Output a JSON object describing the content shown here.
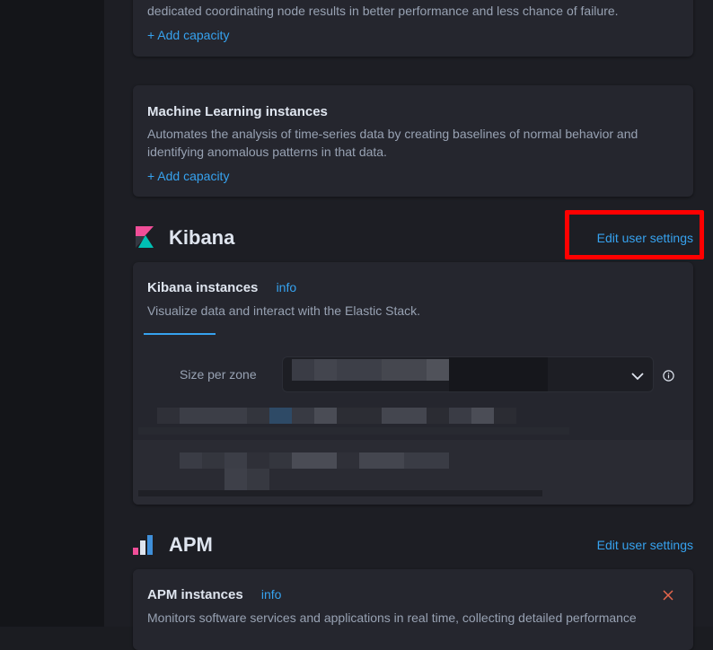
{
  "coordinating": {
    "desc_tail": "dedicated coordinating node results in better performance and less chance of failure.",
    "add_capacity": "+ Add capacity"
  },
  "ml": {
    "title": "Machine Learning instances",
    "desc": "Automates the analysis of time-series data by creating baselines of normal behavior and identifying anomalous patterns in that data.",
    "add_capacity": "+ Add capacity"
  },
  "kibana": {
    "section_title": "Kibana",
    "edit_settings": "Edit user settings",
    "card_title": "Kibana instances",
    "info": "info",
    "desc": "Visualize data and interact with the Elastic Stack.",
    "size_label": "Size per zone"
  },
  "apm": {
    "section_title": "APM",
    "edit_settings": "Edit user settings",
    "card_title": "APM instances",
    "info": "info",
    "desc": "Monitors software services and applications in real time, collecting detailed performance"
  },
  "colors": {
    "accent": "#36a2ef",
    "highlight": "#ff0000",
    "remove": "#e7664c"
  },
  "icons": {
    "kibana_logo": "kibana-logo-icon",
    "apm_logo": "apm-logo-icon",
    "dropdown": "chevron-down-icon",
    "info": "info-circle-icon",
    "remove": "close-icon"
  }
}
